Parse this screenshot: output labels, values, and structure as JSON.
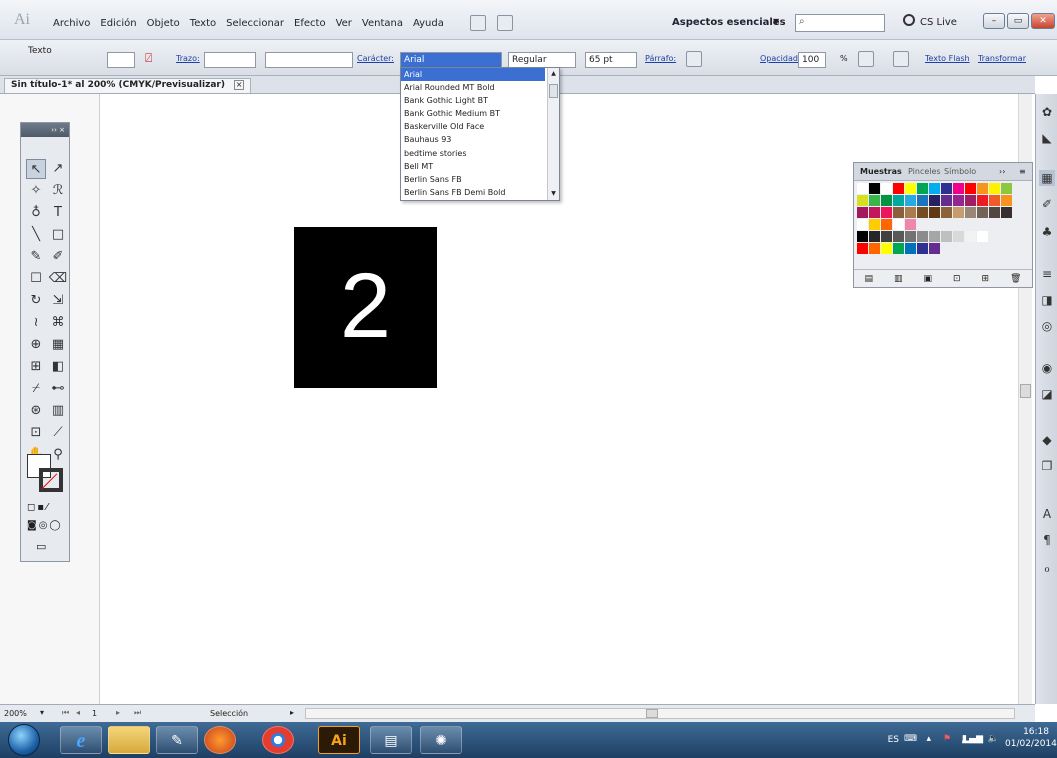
{
  "app": {
    "logo": "Ai",
    "menu": [
      "Archivo",
      "Edición",
      "Objeto",
      "Texto",
      "Seleccionar",
      "Efecto",
      "Ver",
      "Ventana",
      "Ayuda"
    ],
    "workspace": "Aspectos esenciales",
    "cslive": "CS Live"
  },
  "control": {
    "tool_name": "Texto",
    "stroke_label": "Trazo:",
    "char_label": "Carácter:",
    "font_value": "Arial",
    "style_value": "Regular",
    "size_value": "65 pt",
    "paragraph_label": "Párrafo:",
    "opacity_label": "Opacidad:",
    "opacity_value": "100",
    "percent": "%",
    "flash_text_link": "Texto Flash",
    "transform_link": "Transformar"
  },
  "document": {
    "tab_title": "Sin título-1* al 200% (CMYK/Previsualizar)",
    "artwork_text": "2"
  },
  "font_list": {
    "items": [
      "Arial",
      "Arial Rounded MT Bold",
      "Bank Gothic Light BT",
      "Bank Gothic Medium BT",
      "Baskerville Old Face",
      "Bauhaus 93",
      "bedtime stories",
      "Bell MT",
      "Berlin Sans FB",
      "Berlin Sans FB Demi Bold"
    ],
    "selected": "Arial"
  },
  "swatches": {
    "tabs": [
      "Muestras",
      "Pinceles",
      "Símbolo"
    ],
    "rows": [
      [
        "#ffffff",
        "#000000",
        "#ffffff",
        "#ff0000",
        "#ffff00",
        "#00a651",
        "#00aeef",
        "#2e3192",
        "#ec008c",
        "#ff0000",
        "#f7941d",
        "#fff200",
        "#8dc63f"
      ],
      [
        "#d7df23",
        "#39b54a",
        "#009444",
        "#00a99d",
        "#27aae1",
        "#1c75bc",
        "#262262",
        "#662d91",
        "#92278f",
        "#9e1f63",
        "#ed1c24",
        "#f15a29",
        "#f7941d"
      ],
      [
        "#a3195b",
        "#c2185b",
        "#ed145b",
        "#8b5e3c",
        "#a97c50",
        "#754c24",
        "#603913",
        "#8c6239",
        "#c69c6d",
        "#998675",
        "#736357",
        "#534741",
        "#362f2d"
      ],
      [
        "#ffffff",
        "#ffcc00",
        "#ff6600",
        "#ffffff",
        "#ee88aa"
      ],
      [
        "#000000",
        "#262626",
        "#404040",
        "#595959",
        "#737373",
        "#8c8c8c",
        "#a6a6a6",
        "#bfbfbf",
        "#d9d9d9",
        "#f2f2f2",
        "#ffffff"
      ],
      [
        "#ff0000",
        "#ff6600",
        "#ffff00",
        "#00a651",
        "#0072bc",
        "#2e3192",
        "#662d91"
      ]
    ]
  },
  "status": {
    "zoom": "200%",
    "page": "1",
    "selection": "Selección"
  },
  "taskbar": {
    "language": "ES",
    "time": "16:18",
    "date": "01/02/2014",
    "illustrator_label": "Ai"
  }
}
